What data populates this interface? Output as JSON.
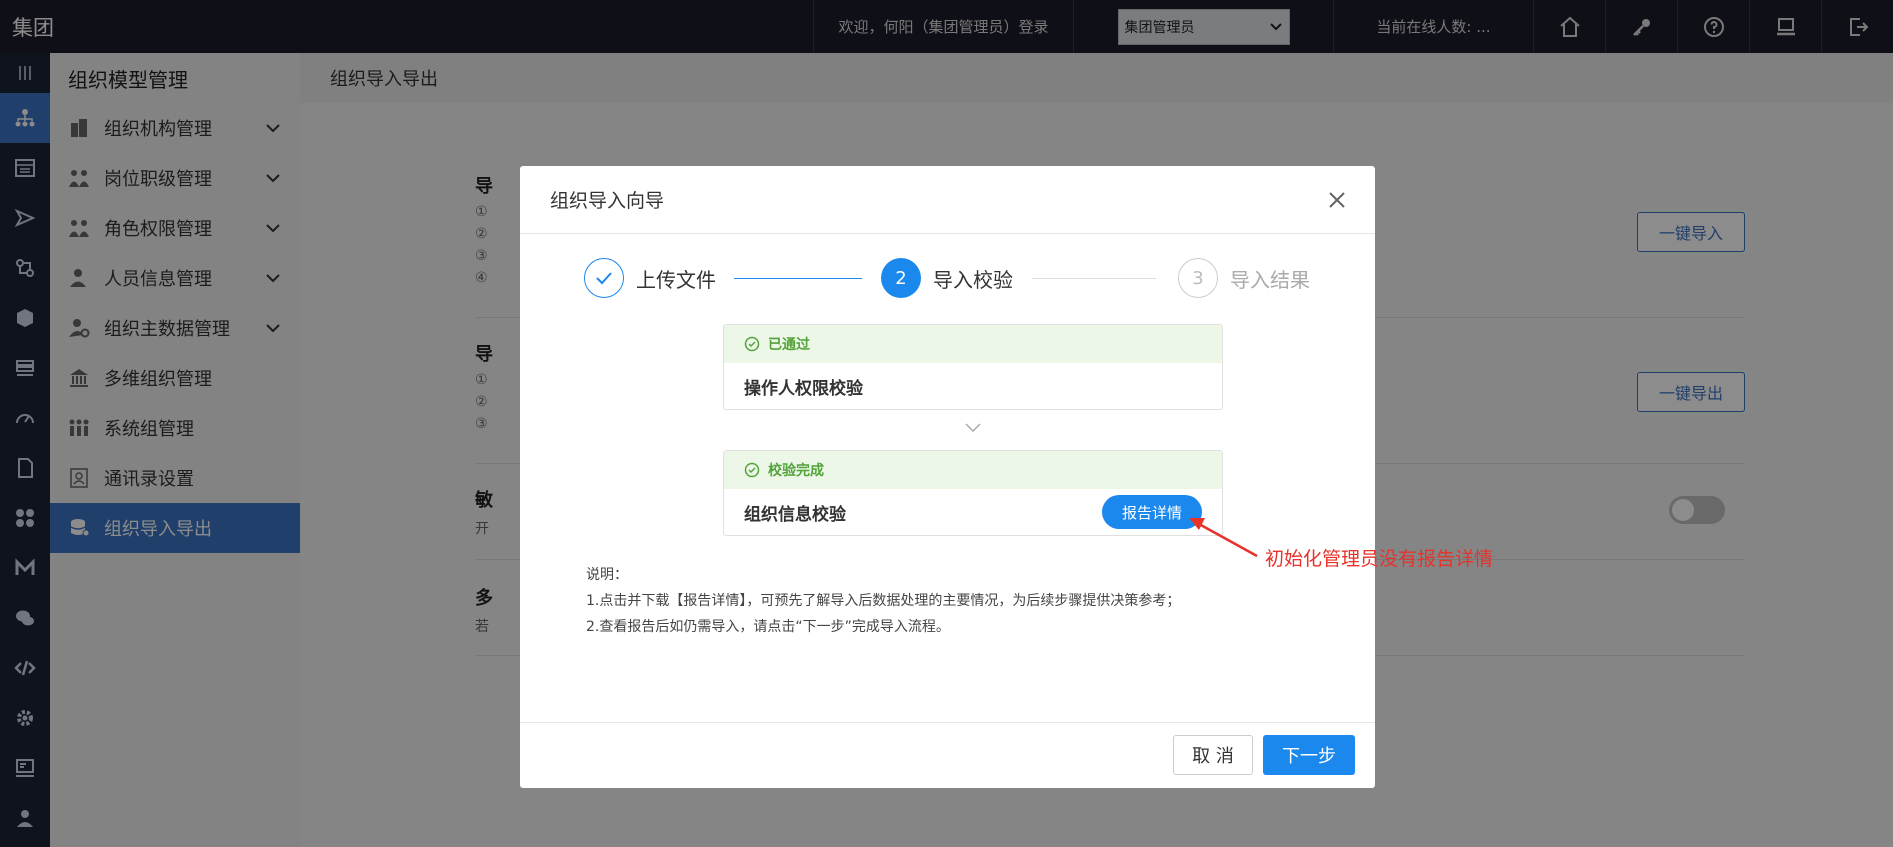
{
  "topbar": {
    "brand": "集团",
    "welcome": "欢迎，何阳（集团管理员）登录",
    "role_selected": "集团管理员",
    "online": "当前在线人数: ...",
    "icons": [
      "home-icon",
      "key-icon",
      "help-icon",
      "monitor-icon",
      "logout-icon"
    ]
  },
  "rail": {
    "items": [
      "menu-icon",
      "org-tree-icon",
      "dashboard-icon",
      "send-icon",
      "flow-icon",
      "shield-icon",
      "layers-icon",
      "gauge-icon",
      "file-icon",
      "apps-icon",
      "m-icon",
      "chat-icon",
      "code-icon",
      "settings-icon",
      "screen-icon",
      "user-icon"
    ]
  },
  "sidebar": {
    "title": "组织模型管理",
    "items": [
      {
        "label": "组织机构管理",
        "icon": "building-icon",
        "expandable": true
      },
      {
        "label": "岗位职级管理",
        "icon": "team-icon",
        "expandable": true
      },
      {
        "label": "角色权限管理",
        "icon": "role-icon",
        "expandable": true
      },
      {
        "label": "人员信息管理",
        "icon": "person-icon",
        "expandable": true
      },
      {
        "label": "组织主数据管理",
        "icon": "person-gear-icon",
        "expandable": true
      },
      {
        "label": "多维组织管理",
        "icon": "bank-icon",
        "expandable": false
      },
      {
        "label": "系统组管理",
        "icon": "group-icon",
        "expandable": false
      },
      {
        "label": "通讯录设置",
        "icon": "contact-icon",
        "expandable": false
      },
      {
        "label": "组织导入导出",
        "icon": "database-icon",
        "expandable": false
      }
    ]
  },
  "content": {
    "breadcrumb": "组织导入导出",
    "sections": [
      {
        "title": "导",
        "lines": [
          "①",
          "②",
          "③",
          "④"
        ],
        "button": "一键导入"
      },
      {
        "title": "导",
        "lines": [
          "①",
          "②",
          "③"
        ],
        "button": "一键导出"
      },
      {
        "title": "敏",
        "lines": [
          "开"
        ]
      },
      {
        "title": "多",
        "lines": [
          "若"
        ]
      }
    ]
  },
  "modal": {
    "title": "组织导入向导",
    "steps": [
      {
        "num": "✓",
        "label": "上传文件"
      },
      {
        "num": "2",
        "label": "导入校验"
      },
      {
        "num": "3",
        "label": "导入结果"
      }
    ],
    "checks": [
      {
        "status": "已通过",
        "name": "操作人权限校验"
      },
      {
        "status": "校验完成",
        "name": "组织信息校验",
        "button": "报告详情"
      }
    ],
    "notes": [
      "说明：",
      "1.点击并下载【报告详情】，可预先了解导入后数据处理的主要情况，为后续步骤提供决策参考；",
      "2.查看报告后如仍需导入，请点击“下一步”完成导入流程。"
    ],
    "cancel": "取 消",
    "next": "下一步"
  },
  "annotation": "初始化管理员没有报告详情",
  "colors": {
    "primary": "#1b88ee",
    "sidebar_active": "#3b73c4",
    "success": "#52a33a",
    "annotation": "#e8322a"
  }
}
